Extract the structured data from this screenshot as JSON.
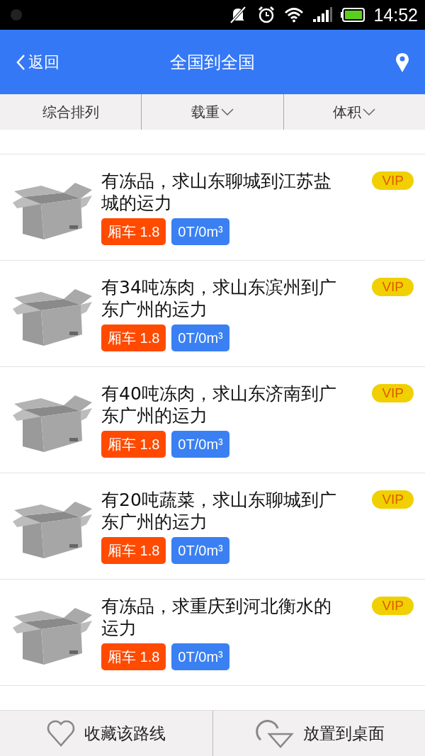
{
  "status_bar": {
    "time": "14:52"
  },
  "header": {
    "back": "返回",
    "title": "全国到全国"
  },
  "filters": [
    {
      "label": "综合排列",
      "dropdown": false
    },
    {
      "label": "载重",
      "dropdown": true
    },
    {
      "label": "体积",
      "dropdown": true
    }
  ],
  "listings": [
    {
      "title": "有冻品，求山东聊城到江苏盐城的运力",
      "badge": "VIP",
      "tags": [
        {
          "label": "厢车 1.8",
          "color": "#ff4a00"
        },
        {
          "label": "0T/0m³",
          "color": "#3a80f2"
        }
      ]
    },
    {
      "title": "有34吨冻肉，求山东滨州到广东广州的运力",
      "badge": "VIP",
      "tags": [
        {
          "label": "厢车 1.8",
          "color": "#ff4a00"
        },
        {
          "label": "0T/0m³",
          "color": "#3a80f2"
        }
      ]
    },
    {
      "title": "有40吨冻肉，求山东济南到广东广州的运力",
      "badge": "VIP",
      "tags": [
        {
          "label": "厢车 1.8",
          "color": "#ff4a00"
        },
        {
          "label": "0T/0m³",
          "color": "#3a80f2"
        }
      ]
    },
    {
      "title": "有20吨蔬菜，求山东聊城到广东广州的运力",
      "badge": "VIP",
      "tags": [
        {
          "label": "厢车 1.8",
          "color": "#ff4a00"
        },
        {
          "label": "0T/0m³",
          "color": "#3a80f2"
        }
      ]
    },
    {
      "title": "有冻品，求重庆到河北衡水的运力",
      "badge": "VIP",
      "tags": [
        {
          "label": "厢车 1.8",
          "color": "#ff4a00"
        },
        {
          "label": "0T/0m³",
          "color": "#3a80f2"
        }
      ]
    }
  ],
  "bottom_actions": [
    {
      "label": "收藏该路线",
      "kind": "heart"
    },
    {
      "label": "放置到桌面",
      "kind": "rotate"
    }
  ]
}
